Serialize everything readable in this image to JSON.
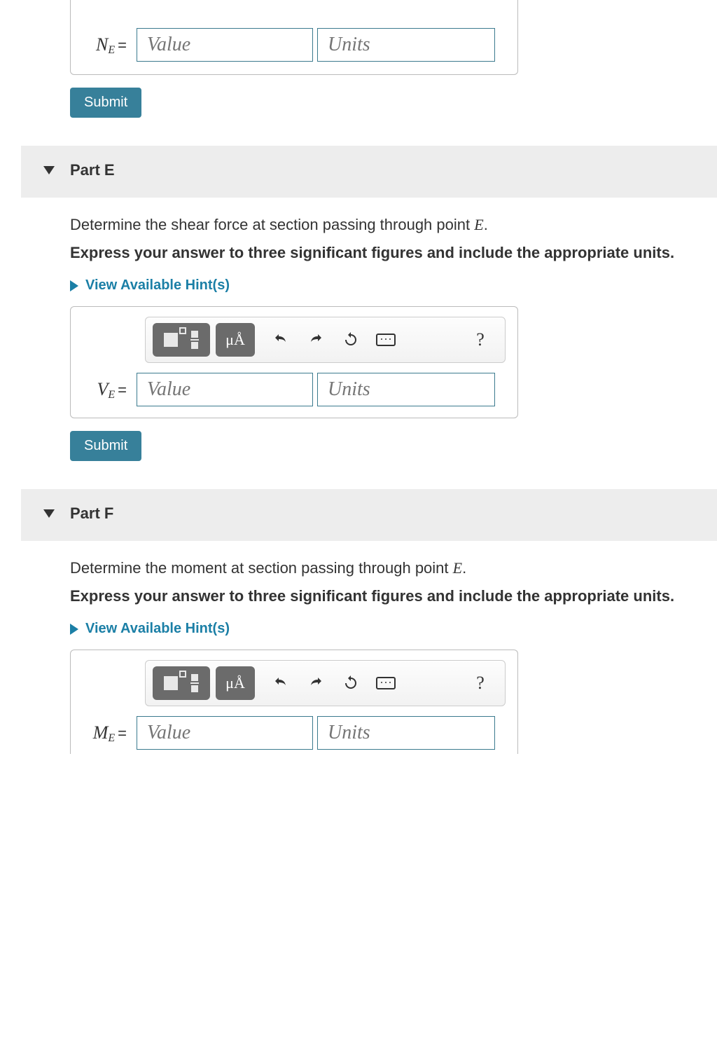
{
  "partD": {
    "var_main": "N",
    "var_sub": "E",
    "value_placeholder": "Value",
    "units_placeholder": "Units",
    "submit": "Submit"
  },
  "partE": {
    "title": "Part E",
    "prompt_pre": "Determine the shear force at section passing through point ",
    "prompt_var": "E",
    "prompt_post": ".",
    "instruction": "Express your answer to three significant figures and include the appropriate units.",
    "hints": "View Available Hint(s)",
    "toolbar": {
      "units_label": "μÅ",
      "help": "?"
    },
    "var_main": "V",
    "var_sub": "E",
    "value_placeholder": "Value",
    "units_placeholder": "Units",
    "submit": "Submit"
  },
  "partF": {
    "title": "Part F",
    "prompt_pre": "Determine the moment at section passing through point ",
    "prompt_var": "E",
    "prompt_post": ".",
    "instruction": "Express your answer to three significant figures and include the appropriate units.",
    "hints": "View Available Hint(s)",
    "toolbar": {
      "units_label": "μÅ",
      "help": "?"
    },
    "var_main": "M",
    "var_sub": "E",
    "value_placeholder": "Value",
    "units_placeholder": "Units"
  }
}
